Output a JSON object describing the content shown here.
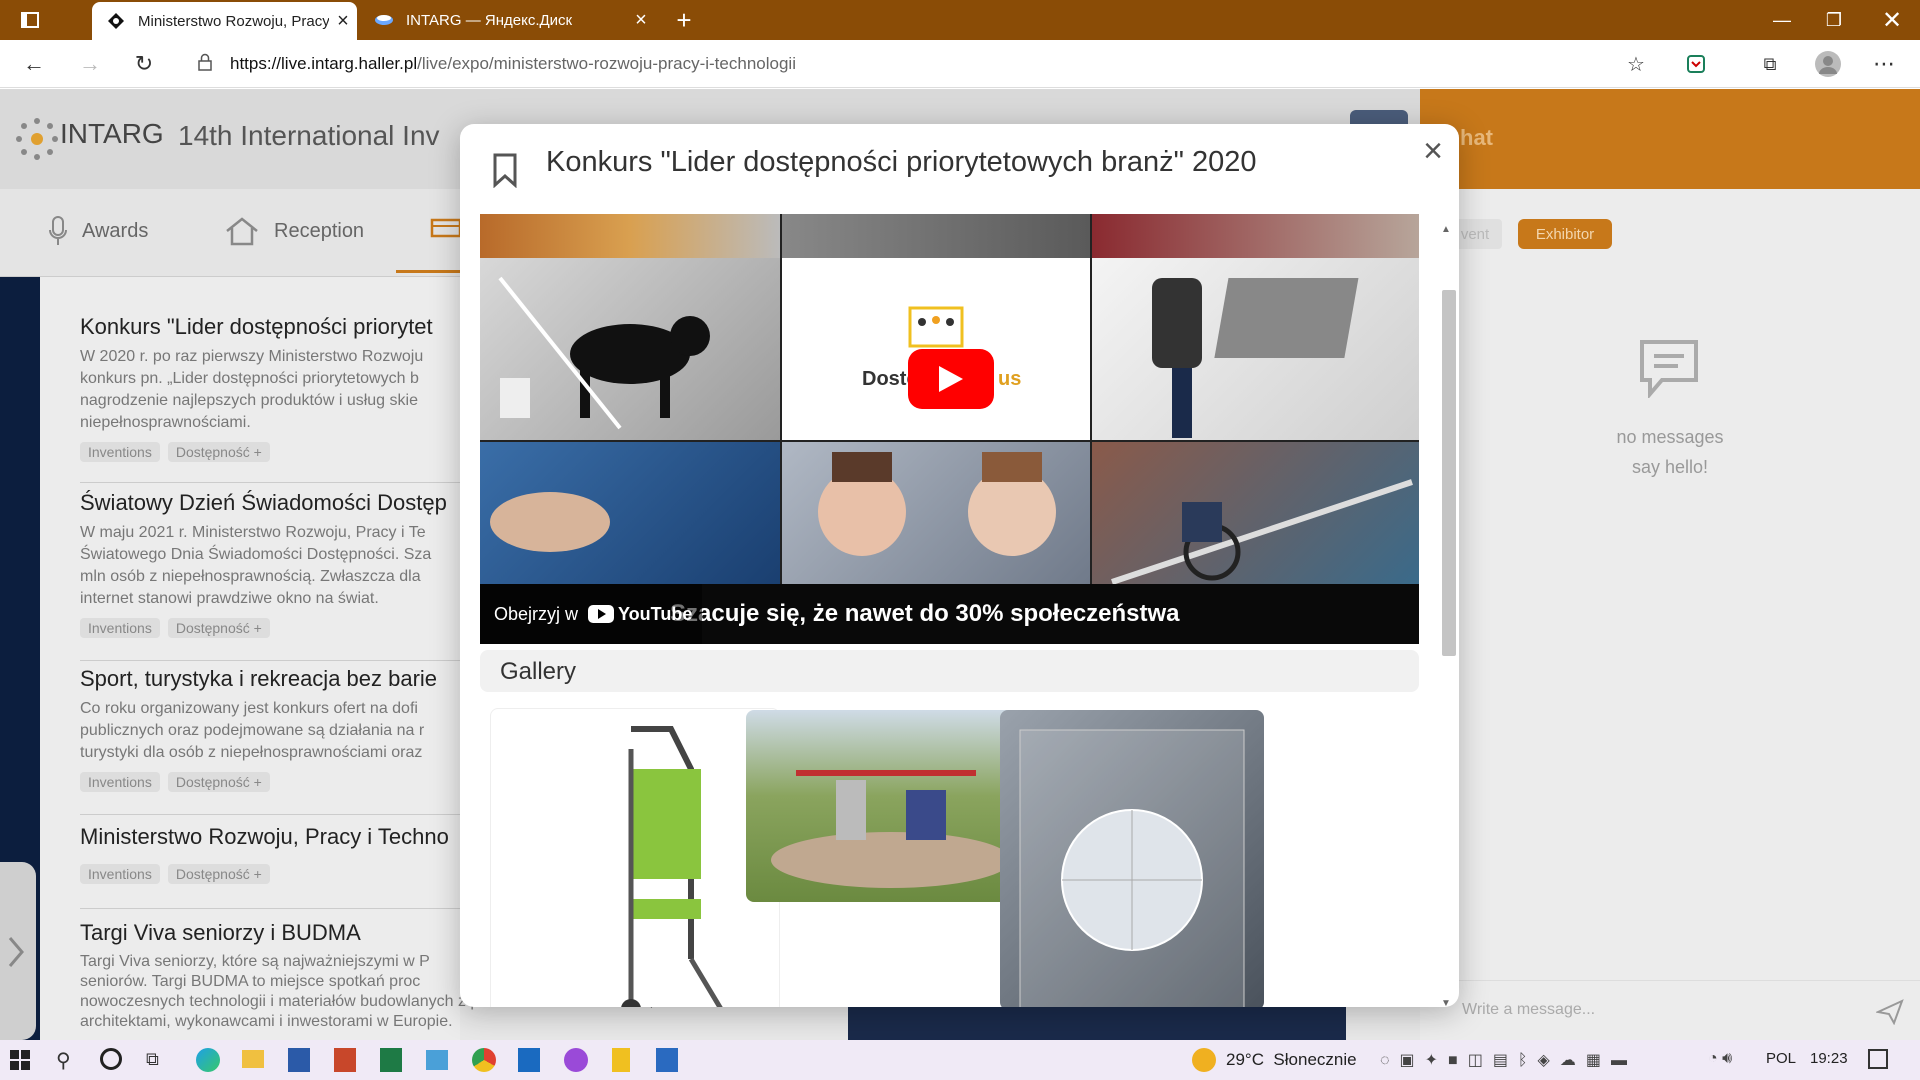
{
  "browser": {
    "tabs": [
      {
        "title": "Ministerstwo Rozwoju, Pracy i Te",
        "active": true
      },
      {
        "title": "INTARG — Яндекс.Диск",
        "active": false
      }
    ],
    "url": {
      "host": "https://live.intarg.haller.pl",
      "path": "/live/expo/ministerstwo-rozwoju-pracy-i-technologii"
    }
  },
  "site": {
    "logo": "INTARG",
    "title": "14th International Inv",
    "nav": [
      {
        "label": "Awards",
        "icon": "microphone-icon"
      },
      {
        "label": "Reception",
        "icon": "home-icon"
      }
    ]
  },
  "list": [
    {
      "title": "Konkurs \"Lider dostępności priorytet",
      "lines": [
        "W 2020 r. po raz pierwszy Ministerstwo Rozwoju",
        "konkurs pn. „Lider dostępności priorytetowych b",
        "nagrodzenie najlepszych produktów i usług skie",
        "niepełnosprawnościami."
      ],
      "tags": [
        "Inventions",
        "Dostępność +"
      ]
    },
    {
      "title": "Światowy Dzień Świadomości Dostęp",
      "lines": [
        "W maju 2021 r. Ministerstwo Rozwoju, Pracy i Te",
        "Światowego Dnia Świadomości Dostępności. Sza",
        "mln osób z niepełnosprawnością. Zwłaszcza dla",
        "internet stanowi prawdziwe okno na świat."
      ],
      "tags": [
        "Inventions",
        "Dostępność +"
      ]
    },
    {
      "title": "Sport, turystyka i rekreacja bez barie",
      "lines": [
        "Co roku organizowany jest konkurs ofert na dofi",
        "publicznych oraz podejmowane są działania na r",
        "turystyki dla osób z niepełnosprawnościami oraz"
      ],
      "tags": [
        "Inventions",
        "Dostępność +"
      ]
    },
    {
      "title": "Ministerstwo Rozwoju, Pracy i Techno",
      "lines": [],
      "tags": [
        "Inventions",
        "Dostępność +"
      ]
    },
    {
      "title": "Targi Viva seniorzy i BUDMA",
      "lines": [
        "Targi Viva seniorzy, które są najważniejszymi w P",
        "seniorów. Targi BUDMA to miejsce spotkań proc",
        "nowoczesnych technologii i materiałów budowlanych z przedstawicielami handlu,",
        "architektami, wykonawcami i inwestorami w Europie."
      ],
      "tags": []
    }
  ],
  "chat": {
    "title": "hat",
    "event_label": "vent",
    "exhibitor_label": "Exhibitor",
    "empty_line1": "no messages",
    "empty_line2": "say hello!",
    "placeholder": "Write a message..."
  },
  "modal": {
    "title": "Konkurs \"Lider dostępności priorytetowych branż\" 2020",
    "video": {
      "watch_on": "Obejrzyj w",
      "yt_word": "YouTube",
      "caption": "Szacuje się, że nawet do 30% społeczeństwa",
      "brand_text_left": "Doste",
      "brand_text_right": "us"
    },
    "gallery_label": "Gallery"
  },
  "taskbar": {
    "weather": "29°C  Słonecznie",
    "lang": "POL",
    "time": "19:23"
  },
  "colors": {
    "accent": "#c7781a",
    "titlebar": "#8a4c06",
    "youtube": "#ff0000"
  }
}
